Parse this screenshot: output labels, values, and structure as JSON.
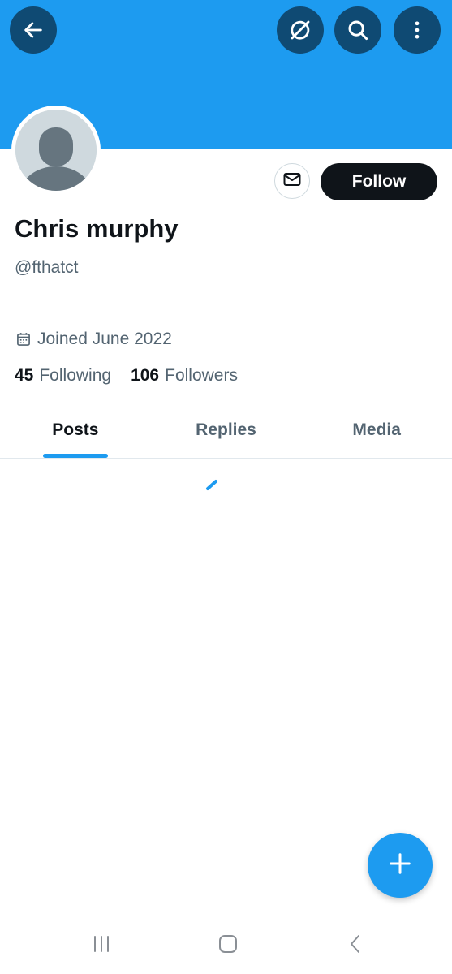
{
  "header": {
    "banner_color": "#1d9bf0",
    "buttons": [
      {
        "icon": "arrow-left-icon"
      },
      {
        "icon": "grok-icon"
      },
      {
        "icon": "search-icon"
      },
      {
        "icon": "more-vertical-icon"
      }
    ]
  },
  "profile": {
    "avatar_icon": "default-avatar-icon",
    "display_name": "Chris murphy",
    "handle": "@fthatct",
    "joined": "Joined June 2022",
    "follow_label": "Follow",
    "message_icon": "envelope-icon",
    "following_count": "45",
    "following_label": "Following",
    "followers_count": "106",
    "followers_label": "Followers"
  },
  "tabs": [
    {
      "label": "Posts",
      "active": true
    },
    {
      "label": "Replies",
      "active": false
    },
    {
      "label": "Media",
      "active": false
    }
  ],
  "accent_color": "#1d9bf0",
  "fab_icon": "plus-icon",
  "system_nav": [
    {
      "icon": "recents-icon"
    },
    {
      "icon": "home-icon"
    },
    {
      "icon": "back-chevron-icon"
    }
  ]
}
